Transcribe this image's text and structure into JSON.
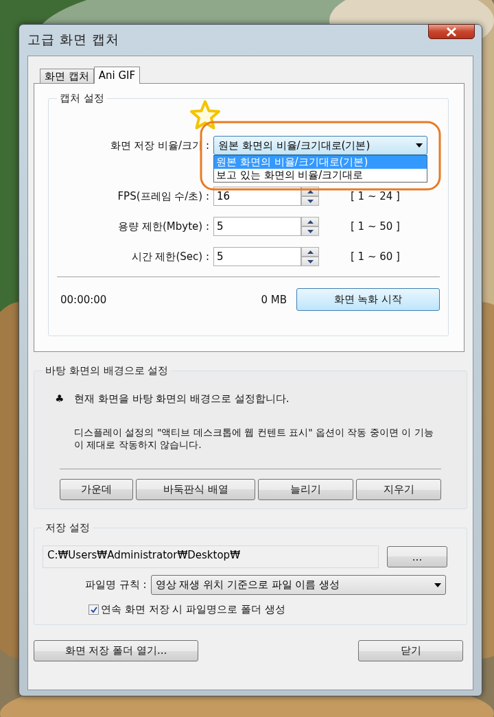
{
  "window": {
    "title": "고급 화면 캡처"
  },
  "tabs": [
    {
      "label": "화면 캡처",
      "selected": false
    },
    {
      "label": "Ani GIF",
      "selected": true
    }
  ],
  "capture_settings": {
    "title": "캡처 설정",
    "fields": [
      {
        "kind": "combo",
        "label": "화면 저장 비율/크기 :",
        "value": "원본 화면의 비율/크기대로(기본)",
        "options": [
          {
            "label": "원본 화면의 비율/크기대로(기본)",
            "selected": true
          },
          {
            "label": "보고 있는 화면의 비율/크기대로",
            "selected": false
          }
        ]
      },
      {
        "kind": "spin",
        "label": "FPS(프레임 수/초) :",
        "value": "16",
        "range": "[ 1 ~ 24 ]"
      },
      {
        "kind": "spin",
        "label": "용량 제한(Mbyte) :",
        "value": "5",
        "range": "[ 1 ~ 50 ]"
      },
      {
        "kind": "spin",
        "label": "시간 제한(Sec) :",
        "value": "5",
        "range": "[ 1 ~ 60 ]"
      }
    ],
    "elapsed": "00:00:00",
    "size": "0 MB",
    "record_button": "화면 녹화 시작"
  },
  "wallpaper": {
    "title": "바탕 화면의 배경으로 설정",
    "bullet": "♣",
    "description": "현재 화면을 바탕 화면의 배경으로 설정합니다.",
    "warning": "디스플레이 설정의 \"액티브 데스크톱에 웹 컨텐트 표시\" 옵션이 작동 중이면 이 기능이 제대로 작동하지 않습니다.",
    "buttons": [
      "가운데",
      "바둑판식 배열",
      "늘리기",
      "지우기"
    ]
  },
  "save_settings": {
    "title": "저장 설정",
    "path": "C:₩Users₩Administrator₩Desktop₩",
    "browse_button": "...",
    "filename_rule": {
      "label": "파일명 규칙 :",
      "value": "영상 재생 위치 기준으로 파일 이름 생성"
    },
    "folder_option": {
      "label": "연속 화면 저장 시 파일명으로 폴더 생성",
      "checked": true
    }
  },
  "footer": {
    "open_folder_button": "화면 저장 폴더 열기...",
    "close_button": "닫기"
  }
}
